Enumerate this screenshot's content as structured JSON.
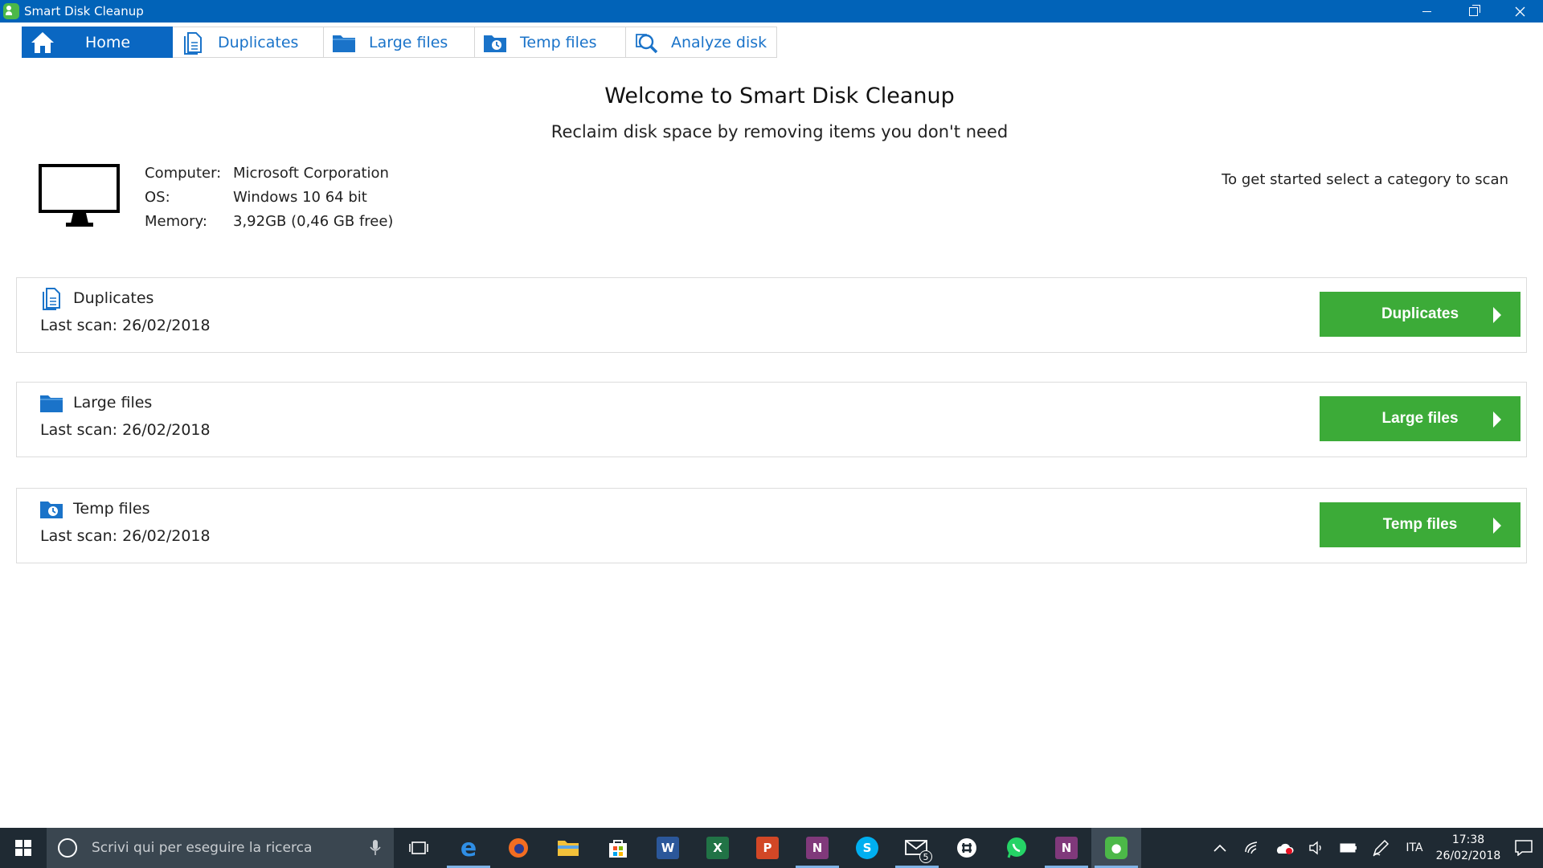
{
  "window": {
    "title": "Smart Disk Cleanup"
  },
  "tabs": [
    {
      "label": "Home",
      "icon": "home-icon",
      "active": true
    },
    {
      "label": "Duplicates",
      "icon": "document-icon"
    },
    {
      "label": "Large files",
      "icon": "folder-icon"
    },
    {
      "label": "Temp files",
      "icon": "temp-folder-icon"
    },
    {
      "label": "Analyze disk",
      "icon": "magnifier-icon"
    }
  ],
  "header": {
    "title": "Welcome to Smart Disk Cleanup",
    "subtitle": "Reclaim disk space by removing items you don't need"
  },
  "system_info": {
    "rows": [
      {
        "label": "Computer:",
        "value": "Microsoft Corporation"
      },
      {
        "label": "OS:",
        "value": "Windows 10 64 bit"
      },
      {
        "label": "Memory:",
        "value": "3,92GB (0,46 GB free)"
      }
    ]
  },
  "hint": "To get started select a category to scan",
  "categories": [
    {
      "title": "Duplicates",
      "last_scan": "Last scan: 26/02/2018",
      "button": "Duplicates",
      "icon": "document-icon"
    },
    {
      "title": "Large files",
      "last_scan": "Last scan: 26/02/2018",
      "button": "Large files",
      "icon": "folder-icon"
    },
    {
      "title": "Temp files",
      "last_scan": "Last scan: 26/02/2018",
      "button": "Temp files",
      "icon": "temp-folder-icon"
    }
  ],
  "taskbar": {
    "search_placeholder": "Scrivi qui per eseguire la ricerca",
    "mail_badge": "5",
    "language": "ITA",
    "time": "17:38",
    "date": "26/02/2018"
  },
  "colors": {
    "titlebar": "#0163b8",
    "accent_blue": "#0a67c2",
    "button_green": "#3cab38",
    "taskbar": "#1f2a33"
  }
}
